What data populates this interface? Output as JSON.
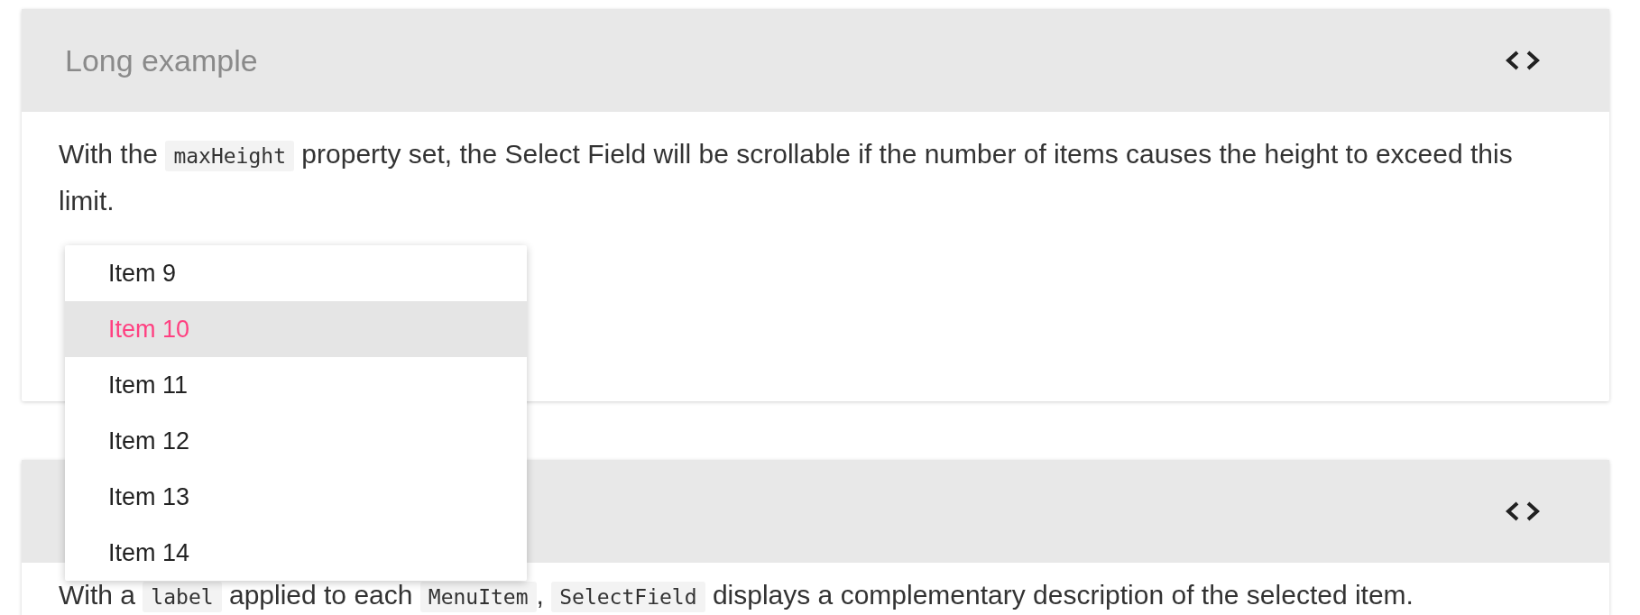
{
  "cards": [
    {
      "title": "Long example",
      "description": [
        {
          "kind": "text",
          "text": "With the "
        },
        {
          "kind": "code",
          "text": "maxHeight"
        },
        {
          "kind": "text",
          "text": " property set, the Select Field will be scrollable if the number of items causes the height to exceed this limit."
        }
      ]
    },
    {
      "description": [
        {
          "kind": "text",
          "text": "With a "
        },
        {
          "kind": "code",
          "text": "label"
        },
        {
          "kind": "text",
          "text": " applied to each "
        },
        {
          "kind": "code",
          "text": "MenuItem"
        },
        {
          "kind": "text",
          "text": ", "
        },
        {
          "kind": "code",
          "text": "SelectField"
        },
        {
          "kind": "text",
          "text": " displays a complementary description of the selected item."
        }
      ]
    }
  ],
  "dropdown": {
    "items": [
      {
        "label": "Item 9",
        "selected": false
      },
      {
        "label": "Item 10",
        "selected": true
      },
      {
        "label": "Item 11",
        "selected": false
      },
      {
        "label": "Item 12",
        "selected": false
      },
      {
        "label": "Item 13",
        "selected": false
      },
      {
        "label": "Item 14",
        "selected": false
      }
    ]
  }
}
